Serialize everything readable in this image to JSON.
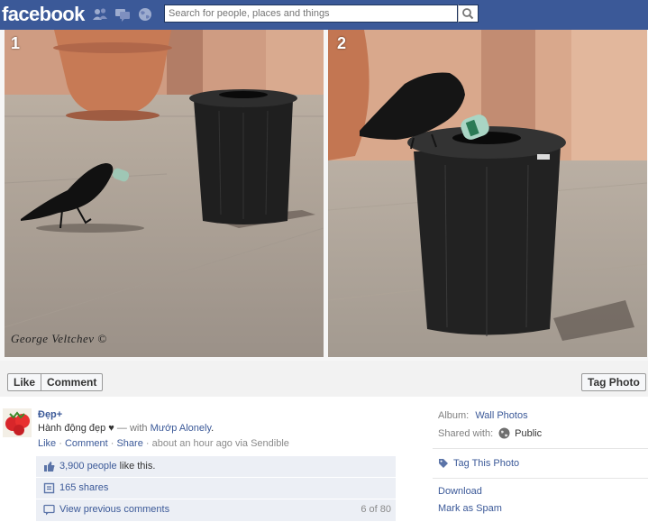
{
  "header": {
    "logo": "facebook",
    "search_placeholder": "Search for people, places and things",
    "icons": [
      "friend-requests-icon",
      "messages-icon",
      "notifications-icon",
      "search-icon"
    ],
    "bg_color": "#3b5998"
  },
  "photo": {
    "panels": [
      {
        "number": "1"
      },
      {
        "number": "2"
      }
    ],
    "watermark": "George Veltchev ©"
  },
  "actions": {
    "like": "Like",
    "comment": "Comment",
    "tag_photo": "Tag Photo"
  },
  "post": {
    "author": "Đẹp+",
    "text_main": "Hành động đẹp ♥",
    "text_with": " — with ",
    "tagged": "Mướp Alonely",
    "text_end": ".",
    "meta": {
      "like": "Like",
      "comment": "Comment",
      "share": "Share",
      "time": "about an hour ago via Sendible",
      "separator": "·"
    },
    "likes": {
      "link": "3,900 people",
      "rest": " like this."
    },
    "shares": "165 shares",
    "view_previous": "View previous comments",
    "comments_count": "6 of 80"
  },
  "sidebar": {
    "album_label": "Album:",
    "album_value": "Wall Photos",
    "shared_label": "Shared with:",
    "shared_value": "Public",
    "tag_this_photo": "Tag This Photo",
    "download": "Download",
    "mark_spam": "Mark as Spam"
  }
}
